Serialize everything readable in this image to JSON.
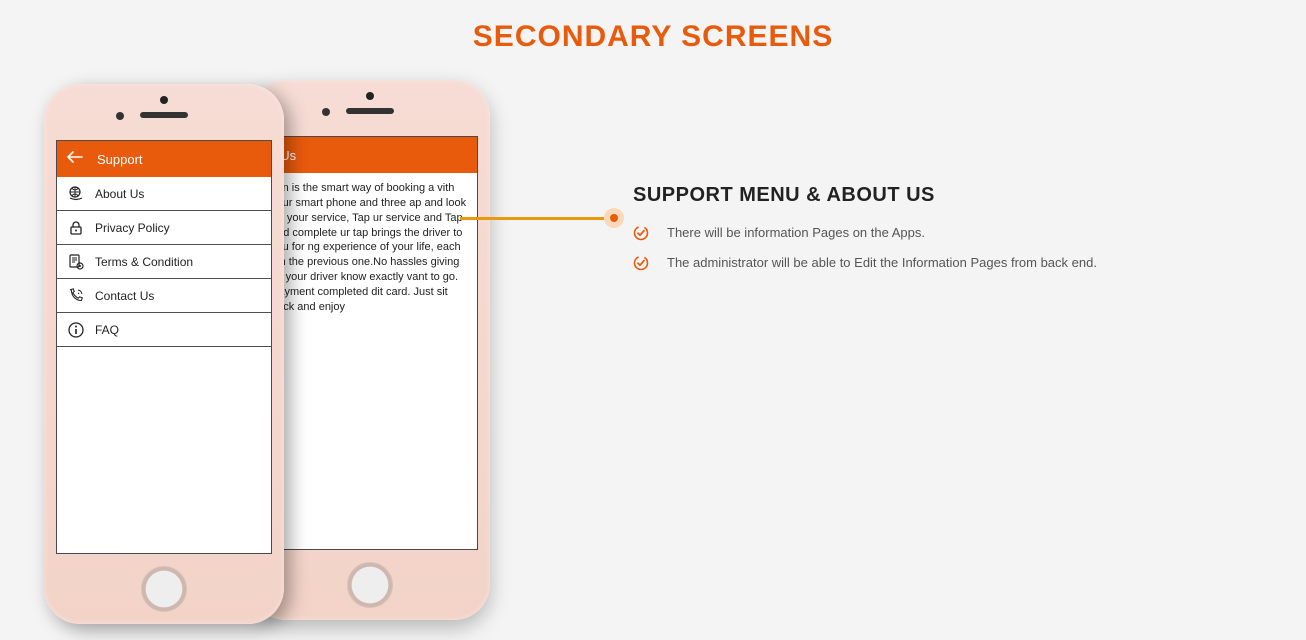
{
  "page": {
    "title": "SECONDARY SCREENS"
  },
  "phone_support": {
    "header_title": "Support",
    "menu": [
      {
        "label": "About Us",
        "icon": "globe-hand-icon"
      },
      {
        "label": "Privacy Policy",
        "icon": "lock-icon"
      },
      {
        "label": "Terms & Condition",
        "icon": "doc-gear-icon"
      },
      {
        "label": "Contact Us",
        "icon": "phone-icon"
      },
      {
        "label": "FAQ",
        "icon": "info-icon"
      }
    ]
  },
  "phone_about": {
    "header_title": "t Us",
    "body_text": "tion is the smart way of booking a vith your smart phone and three ap and look for your service, Tap ur service and Tap and complete ur tap brings the driver to you for ng experience of your life, each ian the previous one.No hassles giving as your driver know exactly vant to go. Payment completed dit card. Just sit back and enjoy"
  },
  "right": {
    "heading": "SUPPORT MENU & ABOUT US",
    "bullets": [
      "There will be information Pages on the Apps.",
      "The administrator will be able to Edit the Information Pages from back end."
    ]
  }
}
